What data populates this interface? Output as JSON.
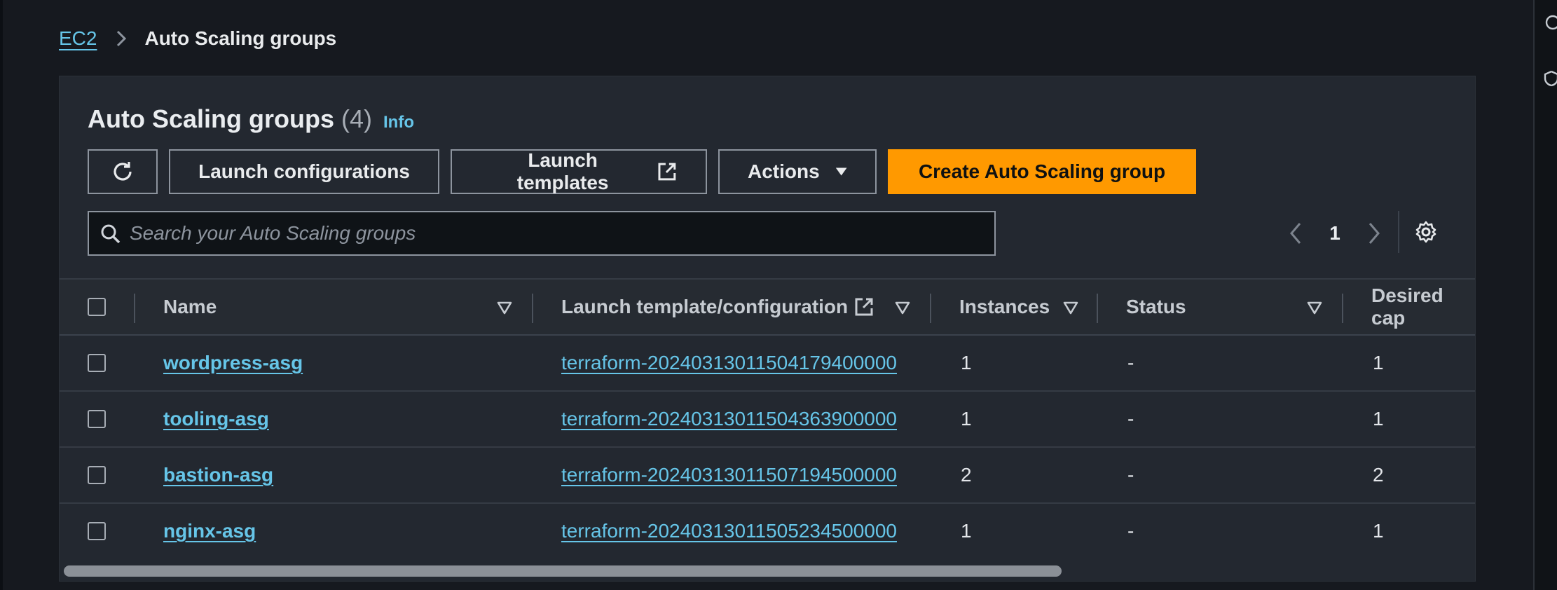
{
  "breadcrumb": {
    "root": "EC2",
    "current": "Auto Scaling groups"
  },
  "panel": {
    "title": "Auto Scaling groups",
    "count": "(4)",
    "info": "Info"
  },
  "toolbar": {
    "launch_configurations": "Launch configurations",
    "launch_templates": "Launch templates",
    "actions": "Actions",
    "create": "Create Auto Scaling group"
  },
  "search": {
    "placeholder": "Search your Auto Scaling groups"
  },
  "pagination": {
    "current_page": "1"
  },
  "table": {
    "columns": {
      "name": "Name",
      "launch_template": "Launch template/configuration",
      "instances": "Instances",
      "status": "Status",
      "desired": "Desired cap"
    },
    "rows": [
      {
        "name": "wordpress-asg",
        "launch_template": "terraform-20240313011504179400000",
        "instances": "1",
        "status": "-",
        "desired": "1"
      },
      {
        "name": "tooling-asg",
        "launch_template": "terraform-20240313011504363900000",
        "instances": "1",
        "status": "-",
        "desired": "1"
      },
      {
        "name": "bastion-asg",
        "launch_template": "terraform-20240313011507194500000",
        "instances": "2",
        "status": "-",
        "desired": "2"
      },
      {
        "name": "nginx-asg",
        "launch_template": "terraform-20240313011505234500000",
        "instances": "1",
        "status": "-",
        "desired": "1"
      }
    ]
  },
  "colors": {
    "accent": "#ff9900",
    "link": "#66c5e8",
    "background": "#16191f",
    "panel": "#232830"
  }
}
